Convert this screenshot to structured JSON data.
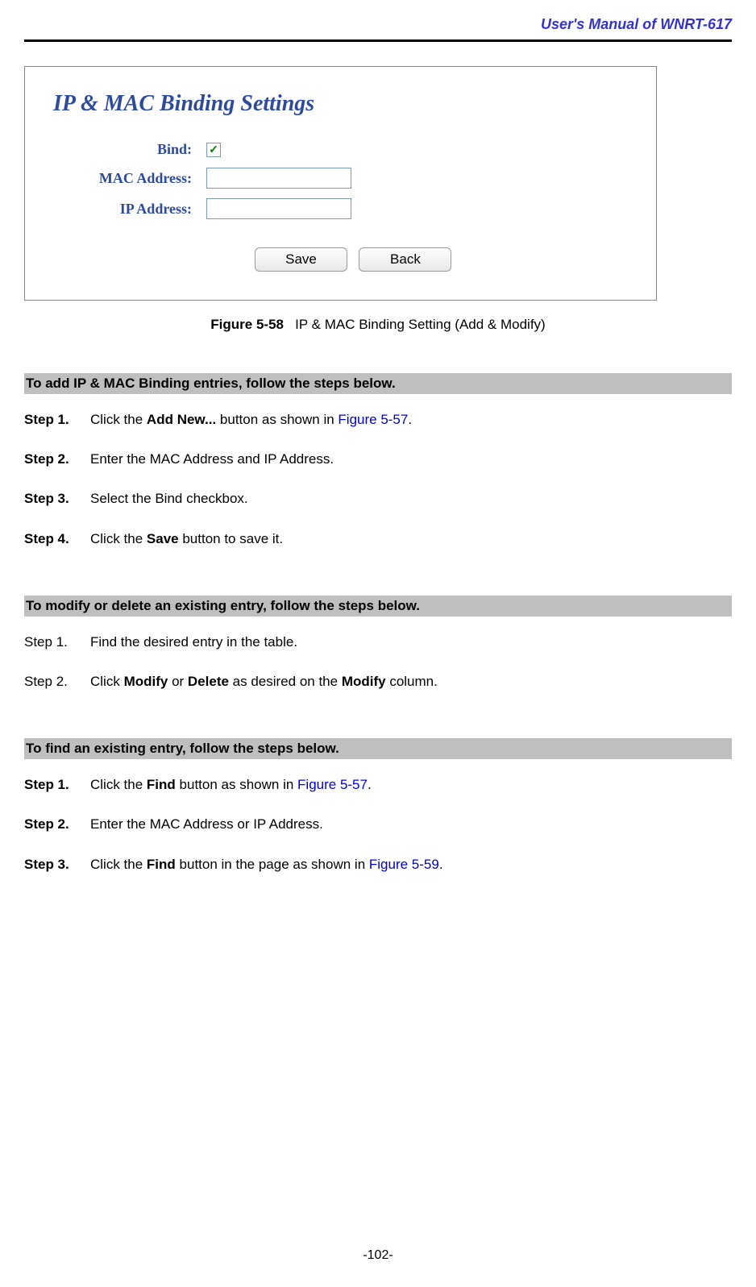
{
  "header": {
    "title": "User's Manual of WNRT-617"
  },
  "screenshot": {
    "settings_title": "IP & MAC Binding Settings",
    "labels": {
      "bind": "Bind:",
      "mac": "MAC Address:",
      "ip": "IP Address:"
    },
    "inputs": {
      "bind_checked": "✓",
      "mac_value": "",
      "ip_value": ""
    },
    "buttons": {
      "save": "Save",
      "back": "Back"
    }
  },
  "caption": {
    "figure_num": "Figure 5-58",
    "figure_text": "IP & MAC Binding Setting (Add & Modify)"
  },
  "section1": {
    "heading": "To add IP & MAC Binding entries, follow the steps below.",
    "steps": [
      {
        "label": "Step 1.",
        "parts": [
          {
            "text": "Click the ",
            "type": "text"
          },
          {
            "text": "Add New...",
            "type": "bold"
          },
          {
            "text": " button as shown in ",
            "type": "text"
          },
          {
            "text": "Figure 5-57",
            "type": "link"
          },
          {
            "text": ".",
            "type": "text"
          }
        ]
      },
      {
        "label": "Step 2.",
        "parts": [
          {
            "text": "Enter the MAC Address and IP Address.",
            "type": "text"
          }
        ]
      },
      {
        "label": "Step 3.",
        "parts": [
          {
            "text": "Select the Bind checkbox.",
            "type": "text"
          }
        ]
      },
      {
        "label": "Step 4.",
        "parts": [
          {
            "text": "Click the ",
            "type": "text"
          },
          {
            "text": "Save",
            "type": "bold"
          },
          {
            "text": " button to save it.",
            "type": "text"
          }
        ]
      }
    ]
  },
  "section2": {
    "heading": "To modify or delete an existing entry, follow the steps below.",
    "steps": [
      {
        "label": "Step 1.",
        "bold_label": false,
        "parts": [
          {
            "text": "Find the desired entry in the table.",
            "type": "text"
          }
        ]
      },
      {
        "label": "Step 2.",
        "bold_label": false,
        "parts": [
          {
            "text": "Click ",
            "type": "text"
          },
          {
            "text": "Modify",
            "type": "bold"
          },
          {
            "text": " or ",
            "type": "text"
          },
          {
            "text": "Delete",
            "type": "bold"
          },
          {
            "text": " as desired on the ",
            "type": "text"
          },
          {
            "text": "Modify",
            "type": "bold"
          },
          {
            "text": " column.",
            "type": "text"
          }
        ]
      }
    ]
  },
  "section3": {
    "heading": "To find an existing entry, follow the steps below.",
    "steps": [
      {
        "label": "Step 1.",
        "parts": [
          {
            "text": "Click the ",
            "type": "text"
          },
          {
            "text": "Find",
            "type": "bold"
          },
          {
            "text": " button as shown in ",
            "type": "text"
          },
          {
            "text": "Figure 5-57",
            "type": "link"
          },
          {
            "text": ".",
            "type": "text"
          }
        ]
      },
      {
        "label": "Step 2.",
        "parts": [
          {
            "text": "Enter the MAC Address or IP Address.",
            "type": "text"
          }
        ]
      },
      {
        "label": "Step 3.",
        "parts": [
          {
            "text": "Click the ",
            "type": "text"
          },
          {
            "text": "Find",
            "type": "bold"
          },
          {
            "text": " button in the page as shown in ",
            "type": "text"
          },
          {
            "text": "Figure 5-59",
            "type": "link"
          },
          {
            "text": ".",
            "type": "text"
          }
        ]
      }
    ]
  },
  "page_number": "-102-"
}
